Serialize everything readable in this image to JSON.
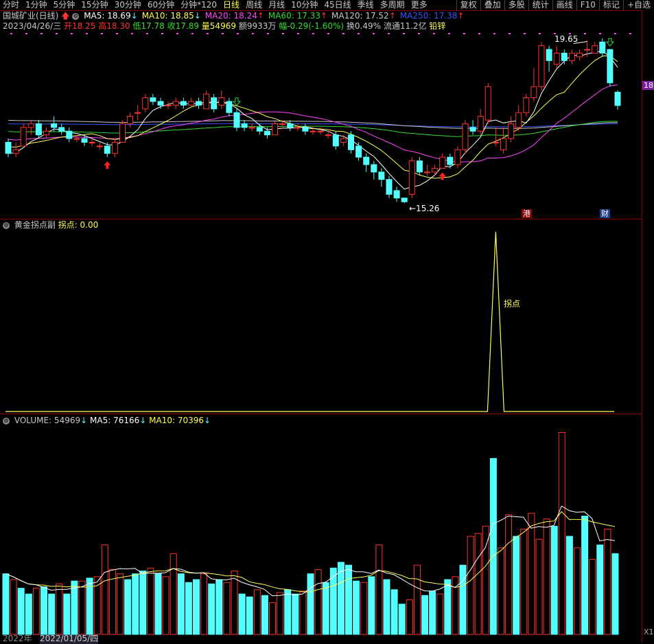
{
  "toolbar": {
    "left": [
      "分时",
      "1分钟",
      "5分钟",
      "15分钟",
      "30分钟",
      "60分钟",
      "分钟*120",
      "日线",
      "周线",
      "月线",
      "10分钟",
      "45日线",
      "季线",
      "多周期",
      "更多"
    ],
    "active": "日线",
    "right": [
      "复权",
      "叠加",
      "多股",
      "统计",
      "画线",
      "F10",
      "标记",
      "+自选"
    ]
  },
  "main": {
    "title": "国城矿业(日线)",
    "ma": [
      {
        "label": "MA5: 18.69",
        "arrow": "↓",
        "color": "#ffffff"
      },
      {
        "label": "MA10: 18.85",
        "arrow": "↓",
        "color": "#ffff54"
      },
      {
        "label": "MA20: 18.24",
        "arrow": "↑",
        "color": "#ff44ff"
      },
      {
        "label": "MA60: 17.33",
        "arrow": "↑",
        "color": "#33dd33"
      },
      {
        "label": "MA120: 17.52",
        "arrow": "↑",
        "color": "#c8c8c8"
      },
      {
        "label": "MA250: 17.38",
        "arrow": "↑",
        "color": "#3355ff"
      }
    ],
    "date": "2023/04/26/三",
    "open": "开18.25",
    "high": "高18.30",
    "low": "低17.78",
    "close": "收17.89",
    "vol": "量54969",
    "amount": "额9933万",
    "amp": "幅-0.29(-1.60%)",
    "turnover": "换0.49%",
    "float": "流通11.2亿",
    "sector": "铅锌",
    "max_label": "19.65",
    "min_label": "←15.26",
    "right_axis": "18",
    "tag_hk": "港",
    "tag_fin": "财"
  },
  "sub": {
    "title": "黄金拐点副",
    "value_label": "拐点: 0.00",
    "peak_label": "拐点"
  },
  "volume_panel": {
    "title": "VOLUME: 54969",
    "ma5": "MA5: 76166",
    "ma10": "MA10: 70396",
    "right_tag": "X1"
  },
  "bottom": {
    "d1": "2022年",
    "d2": "2022/01/05/四"
  },
  "colors": {
    "up": "#ff3232",
    "down": "#54ffff",
    "ma5": "#ffffff",
    "ma10": "#ffff54",
    "ma20": "#ff44ff",
    "ma60": "#33dd33",
    "ma120": "#c8c8c8",
    "ma250": "#3355ff"
  },
  "chart_data": {
    "type": "candlestick",
    "candles": [
      [
        16.9,
        16.6,
        17.0,
        16.5
      ],
      [
        16.6,
        16.7,
        16.9,
        16.5
      ],
      [
        16.8,
        17.3,
        17.4,
        16.8
      ],
      [
        17.3,
        17.4,
        17.5,
        17.1
      ],
      [
        17.4,
        17.1,
        17.5,
        17.0
      ],
      [
        17.1,
        17.2,
        17.3,
        17.0
      ],
      [
        17.4,
        17.3,
        17.6,
        17.2
      ],
      [
        17.3,
        17.2,
        17.4,
        17.1
      ],
      [
        17.2,
        17.0,
        17.3,
        16.9
      ],
      [
        17.0,
        17.0,
        17.1,
        16.9
      ],
      [
        17.0,
        16.9,
        17.1,
        16.8
      ],
      [
        16.9,
        16.9,
        17.0,
        16.8
      ],
      [
        16.8,
        16.8,
        16.9,
        16.7
      ],
      [
        16.8,
        16.6,
        16.9,
        16.5
      ],
      [
        16.6,
        16.9,
        17.0,
        16.5
      ],
      [
        16.9,
        17.4,
        17.5,
        16.9
      ],
      [
        17.4,
        17.6,
        17.7,
        17.3
      ],
      [
        17.7,
        17.7,
        17.9,
        17.5
      ],
      [
        17.8,
        18.1,
        18.2,
        17.7
      ],
      [
        18.1,
        18.0,
        18.2,
        17.9
      ],
      [
        18.0,
        17.9,
        18.1,
        17.8
      ],
      [
        17.9,
        17.9,
        18.0,
        17.8
      ],
      [
        17.9,
        18.0,
        18.1,
        17.8
      ],
      [
        18.0,
        17.9,
        18.1,
        17.8
      ],
      [
        17.9,
        18.0,
        18.1,
        17.9
      ],
      [
        18.0,
        17.9,
        18.1,
        17.8
      ],
      [
        17.8,
        18.2,
        18.3,
        17.8
      ],
      [
        18.1,
        17.8,
        18.2,
        17.7
      ],
      [
        17.9,
        18.1,
        18.3,
        17.8
      ],
      [
        18.0,
        17.7,
        18.1,
        17.6
      ],
      [
        17.7,
        17.3,
        17.8,
        17.2
      ],
      [
        17.4,
        17.3,
        17.5,
        17.2
      ],
      [
        17.3,
        17.3,
        17.4,
        17.2
      ],
      [
        17.3,
        17.2,
        17.4,
        17.1
      ],
      [
        17.2,
        17.1,
        17.3,
        17.0
      ],
      [
        17.1,
        17.4,
        17.5,
        17.1
      ],
      [
        17.4,
        17.4,
        17.5,
        17.3
      ],
      [
        17.4,
        17.3,
        17.5,
        17.2
      ],
      [
        17.3,
        17.3,
        17.4,
        17.2
      ],
      [
        17.3,
        17.2,
        17.4,
        17.1
      ],
      [
        17.2,
        17.2,
        17.3,
        17.1
      ],
      [
        17.2,
        17.2,
        17.3,
        17.1
      ],
      [
        17.1,
        17.1,
        17.2,
        17.0
      ],
      [
        17.1,
        16.8,
        17.2,
        16.7
      ],
      [
        16.9,
        17.0,
        17.1,
        16.8
      ],
      [
        17.1,
        16.7,
        17.2,
        16.6
      ],
      [
        16.8,
        16.5,
        16.9,
        16.4
      ],
      [
        16.5,
        16.3,
        16.6,
        16.1
      ],
      [
        16.3,
        16.1,
        16.4,
        15.9
      ],
      [
        16.1,
        15.9,
        16.2,
        15.7
      ],
      [
        15.9,
        15.5,
        16.0,
        15.4
      ],
      [
        15.6,
        15.4,
        15.7,
        15.3
      ],
      [
        15.4,
        15.3,
        15.4,
        15.26
      ],
      [
        15.5,
        16.4,
        16.5,
        15.4
      ],
      [
        16.4,
        16.1,
        16.5,
        16.0
      ],
      [
        16.1,
        16.1,
        16.3,
        16.0
      ],
      [
        16.1,
        16.2,
        16.3,
        16.0
      ],
      [
        16.2,
        16.5,
        16.6,
        16.2
      ],
      [
        16.5,
        16.3,
        16.6,
        16.2
      ],
      [
        16.3,
        16.7,
        16.8,
        16.2
      ],
      [
        16.7,
        17.4,
        17.5,
        16.6
      ],
      [
        17.3,
        17.2,
        17.5,
        17.1
      ],
      [
        17.2,
        17.6,
        17.8,
        17.1
      ],
      [
        17.5,
        18.4,
        18.5,
        17.4
      ],
      [
        16.9,
        16.9,
        17.3,
        16.8
      ],
      [
        16.7,
        17.0,
        17.3,
        16.6
      ],
      [
        17.0,
        17.4,
        17.6,
        16.9
      ],
      [
        17.3,
        17.7,
        17.9,
        17.2
      ],
      [
        17.7,
        18.1,
        18.2,
        17.6
      ],
      [
        18.1,
        18.4,
        18.9,
        18.0
      ],
      [
        18.4,
        19.5,
        19.6,
        18.3
      ],
      [
        19.4,
        19.1,
        19.5,
        18.8
      ],
      [
        19.0,
        19.3,
        19.5,
        18.9
      ],
      [
        19.3,
        19.1,
        19.4,
        19.0
      ],
      [
        19.1,
        19.3,
        19.4,
        19.0
      ],
      [
        19.2,
        19.3,
        19.4,
        19.1
      ],
      [
        19.4,
        19.4,
        19.65,
        19.2
      ],
      [
        19.3,
        19.5,
        19.6,
        19.3
      ],
      [
        19.6,
        19.3,
        19.7,
        19.2
      ],
      [
        19.4,
        18.5,
        19.4,
        18.4
      ],
      [
        18.25,
        17.89,
        18.3,
        17.78
      ]
    ],
    "volume": [
      [
        42000,
        "d"
      ],
      [
        38000,
        "u"
      ],
      [
        32000,
        "d"
      ],
      [
        28000,
        "d"
      ],
      [
        32000,
        "u"
      ],
      [
        33000,
        "d"
      ],
      [
        28000,
        "d"
      ],
      [
        35000,
        "u"
      ],
      [
        28000,
        "d"
      ],
      [
        37000,
        "d"
      ],
      [
        37000,
        "u"
      ],
      [
        39000,
        "d"
      ],
      [
        40000,
        "u"
      ],
      [
        62000,
        "u"
      ],
      [
        45000,
        "u"
      ],
      [
        42000,
        "u"
      ],
      [
        38000,
        "d"
      ],
      [
        42000,
        "d"
      ],
      [
        44000,
        "d"
      ],
      [
        46000,
        "u"
      ],
      [
        42000,
        "d"
      ],
      [
        40000,
        "u"
      ],
      [
        56000,
        "u"
      ],
      [
        42000,
        "d"
      ],
      [
        36000,
        "d"
      ],
      [
        38000,
        "d"
      ],
      [
        42000,
        "u"
      ],
      [
        35000,
        "d"
      ],
      [
        38000,
        "d"
      ],
      [
        36000,
        "u"
      ],
      [
        44000,
        "u"
      ],
      [
        28000,
        "d"
      ],
      [
        26000,
        "d"
      ],
      [
        31000,
        "u"
      ],
      [
        27000,
        "d"
      ],
      [
        22000,
        "u"
      ],
      [
        29000,
        "u"
      ],
      [
        31000,
        "d"
      ],
      [
        28000,
        "d"
      ],
      [
        30000,
        "u"
      ],
      [
        42000,
        "d"
      ],
      [
        45000,
        "u"
      ],
      [
        36000,
        "d"
      ],
      [
        46000,
        "d"
      ],
      [
        50000,
        "d"
      ],
      [
        48000,
        "d"
      ],
      [
        37000,
        "d"
      ],
      [
        36000,
        "u"
      ],
      [
        40000,
        "d"
      ],
      [
        62000,
        "u"
      ],
      [
        38000,
        "d"
      ],
      [
        31000,
        "d"
      ],
      [
        21000,
        "d"
      ],
      [
        24000,
        "u"
      ],
      [
        48000,
        "u"
      ],
      [
        27000,
        "d"
      ],
      [
        30000,
        "d"
      ],
      [
        28000,
        "u"
      ],
      [
        38000,
        "d"
      ],
      [
        40000,
        "u"
      ],
      [
        48000,
        "d"
      ],
      [
        68000,
        "u"
      ],
      [
        70000,
        "u"
      ],
      [
        75000,
        "u"
      ],
      [
        122000,
        "d"
      ],
      [
        60000,
        "u"
      ],
      [
        83000,
        "u"
      ],
      [
        68000,
        "d"
      ],
      [
        73000,
        "u"
      ],
      [
        84000,
        "u"
      ],
      [
        66000,
        "u"
      ],
      [
        80000,
        "u"
      ],
      [
        75000,
        "d"
      ],
      [
        140000,
        "u"
      ],
      [
        68000,
        "d"
      ],
      [
        60000,
        "u"
      ],
      [
        82000,
        "d"
      ],
      [
        52000,
        "u"
      ],
      [
        62000,
        "d"
      ],
      [
        73000,
        "u"
      ],
      [
        56000,
        "d"
      ]
    ],
    "indicator": {
      "name": "拐点",
      "peak_index": 64,
      "peak_value": 1,
      "base": 0
    }
  }
}
